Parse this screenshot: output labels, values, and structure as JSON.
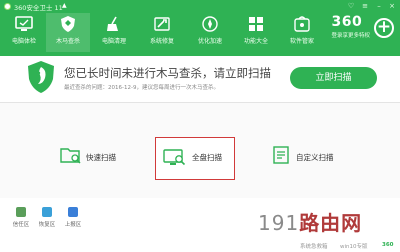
{
  "window": {
    "title": "360安全卫士 11",
    "controls": {
      "skin": "♡",
      "menu": "≡",
      "minimize": "–",
      "close": "×"
    }
  },
  "nav": {
    "items": [
      {
        "label": "电脑体检",
        "icon": "monitor-check-icon",
        "color": "#7fd26a"
      },
      {
        "label": "木马查杀",
        "icon": "shield-scan-icon",
        "color": "#ffffff"
      },
      {
        "label": "电脑清理",
        "icon": "broom-icon",
        "color": "#7fd26a"
      },
      {
        "label": "系统修复",
        "icon": "wrench-icon",
        "color": "#7fd26a"
      },
      {
        "label": "优化加速",
        "icon": "rocket-icon",
        "color": "#7fd26a"
      },
      {
        "label": "功能大全",
        "icon": "grid-icon",
        "color": "#7fd26a"
      },
      {
        "label": "软件管家",
        "icon": "software-store-icon",
        "color": "#7fd26a"
      }
    ],
    "active_index": 1
  },
  "brand": {
    "name": "360",
    "tagline": "登录享更多特权"
  },
  "banner": {
    "title": "您已长时间未进行木马查杀，请立即扫描",
    "subtitle": "最近查杀的问题：2016-12-9，建议您每周进行一次木马查杀。",
    "scan_button": "立即扫描"
  },
  "scan_options": {
    "quick": "快速扫描",
    "full": "全盘扫描",
    "custom": "自定义扫描"
  },
  "footer": {
    "items": [
      {
        "label": "信任区",
        "icon": "trust-zone-icon",
        "color": "#5a9e5a"
      },
      {
        "label": "恢复区",
        "icon": "restore-zone-icon",
        "color": "#3aa0d8"
      },
      {
        "label": "上报区",
        "icon": "report-zone-icon",
        "color": "#3a7fd8"
      }
    ],
    "status_left": "系统急救箱",
    "status_right": "win10专版",
    "brand": "360"
  },
  "watermark": {
    "num": "191",
    "cn": "路由网"
  },
  "colors": {
    "brand_green": "#2fb254",
    "highlight_red": "#d13a3a"
  }
}
